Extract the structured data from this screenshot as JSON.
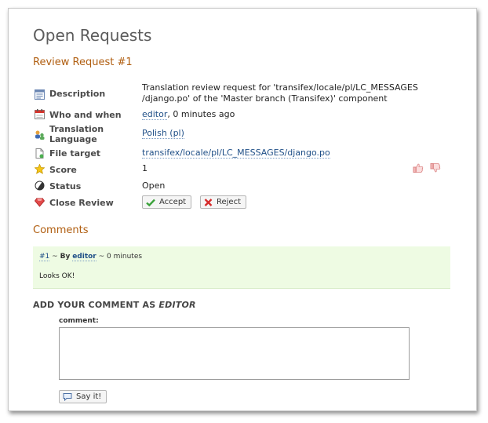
{
  "page": {
    "title": "Open Requests",
    "subtitle": "Review Request #1"
  },
  "details": {
    "description_label": "Description",
    "description_value": "Translation review request for 'transifex/locale/pl/LC_MESSAGES /django.po' of the 'Master branch (Transifex)' component",
    "description_line1": "Translation review request for 'transifex/locale/pl/LC_MESSAGES",
    "description_line2": "/django.po' of the 'Master branch (Transifex)' component",
    "who_label": "Who and when",
    "who_user": "editor",
    "who_time": ", 0 minutes ago",
    "language_label_1": "Translation",
    "language_label_2": "Language",
    "language_value": "Polish (pl)",
    "file_label": "File target",
    "file_value": "transifex/locale/pl/LC_MESSAGES/django.po",
    "score_label": "Score",
    "score_value": "1",
    "status_label": "Status",
    "status_value": "Open",
    "close_label": "Close Review",
    "accept_label": "Accept",
    "reject_label": "Reject"
  },
  "comments": {
    "heading": "Comments",
    "items": [
      {
        "number": "#1",
        "separator": "~",
        "by_label": "By",
        "author": "editor",
        "time": "~ 0 minutes",
        "text": "Looks OK!"
      }
    ]
  },
  "add_comment": {
    "heading_prefix": "ADD YOUR COMMENT AS ",
    "heading_user": "EDITOR",
    "field_label": "comment:",
    "textarea_value": "",
    "submit_label": "Say it!"
  },
  "icons": {
    "description": "note-icon",
    "who": "calendar-icon",
    "language": "language-icon",
    "file": "file-icon",
    "score": "star-icon",
    "status": "status-icon",
    "close": "ruby-icon",
    "thumb_up": "thumb-up-icon",
    "thumb_down": "thumb-down-icon",
    "accept": "check-icon",
    "reject": "cross-icon",
    "say": "speech-bubble-icon"
  },
  "colors": {
    "heading_orange": "#b05e10",
    "link_blue": "#1f4f87",
    "comment_bg": "#eefbe3"
  }
}
